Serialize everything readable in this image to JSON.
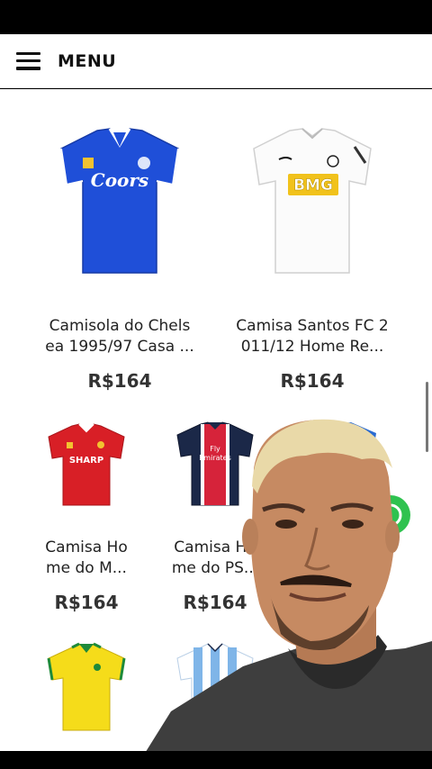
{
  "header": {
    "menu_label": "MENU"
  },
  "products": [
    {
      "name": "Camisola do Chels ea 1995/97 Casa ...",
      "price": "R$164"
    },
    {
      "name": "Camisa Santos FC 2 011/12 Home Re...",
      "price": "R$164"
    },
    {
      "name": "Camisa Ho me do M...",
      "price": "R$164"
    },
    {
      "name": "Camisa Ho me do PS...",
      "price": "R$164"
    },
    {
      "name": "",
      "price": ""
    },
    {
      "name": "",
      "price": ""
    }
  ],
  "shirt_text": {
    "chelsea_sponsor": "Coors",
    "santos_sponsor": "BMG",
    "united_sponsor": "SHARP",
    "psg_sponsor_line1": "Fly",
    "psg_sponsor_line2": "Emirates"
  },
  "colors": {
    "chelsea_blue": "#1f4fd8",
    "united_red": "#d81f26",
    "psg_navy": "#1b2848",
    "brazil_yellow": "#f5dc1a",
    "whatsapp_green": "#2fc24f"
  }
}
